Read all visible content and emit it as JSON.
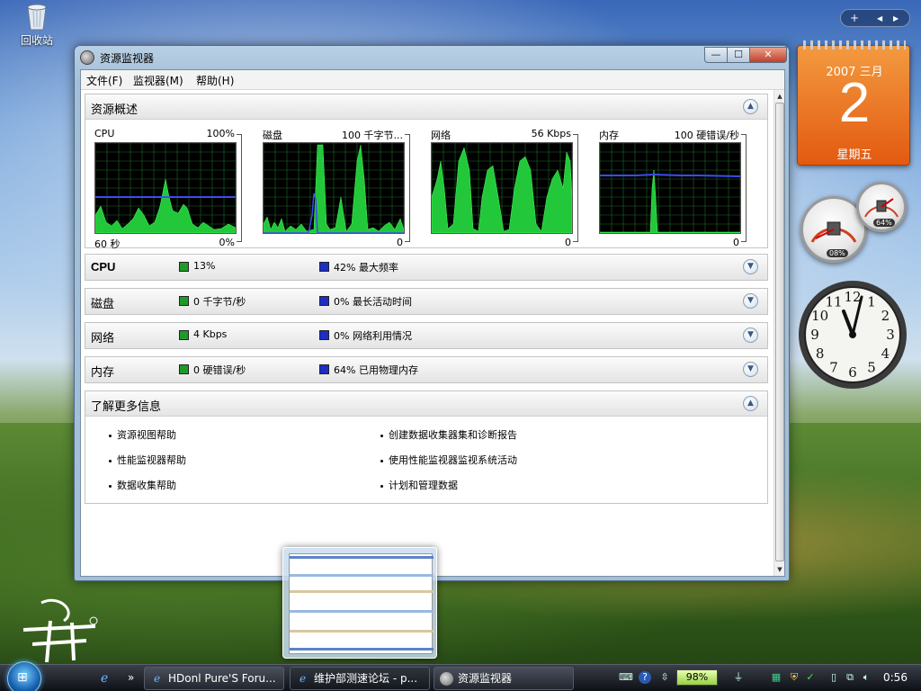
{
  "desktop": {
    "recycle_label": "回收站"
  },
  "window": {
    "title": "资源监视器",
    "controls": {
      "close_symbol": "✕",
      "min_symbol": "—",
      "max_symbol": "☐"
    },
    "menu": [
      {
        "label": "文件(F)"
      },
      {
        "label": "监视器(M)"
      },
      {
        "label": "帮助(H)"
      }
    ],
    "overview": {
      "title": "资源概述",
      "graphs": [
        {
          "label": "CPU",
          "scale": "100%",
          "foot_left": "60 秒",
          "foot_right": "0%"
        },
        {
          "label": "磁盘",
          "scale": "100 千字节...",
          "foot_left": "",
          "foot_right": "0"
        },
        {
          "label": "网络",
          "scale": "56 Kbps",
          "foot_left": "",
          "foot_right": "0"
        },
        {
          "label": "内存",
          "scale": "100 硬错误/秒",
          "foot_left": "",
          "foot_right": "0"
        }
      ]
    },
    "sections": [
      {
        "title": "CPU",
        "green_text": "13%",
        "blue_text": "42% 最大频率"
      },
      {
        "title": "磁盘",
        "green_text": "0 千字节/秒",
        "blue_text": "0% 最长活动时间"
      },
      {
        "title": "网络",
        "green_text": "4 Kbps",
        "blue_text": "0% 网络利用情况"
      },
      {
        "title": "内存",
        "green_text": "0 硬错误/秒",
        "blue_text": "64% 已用物理内存"
      }
    ],
    "learn_more": {
      "title": "了解更多信息",
      "links": [
        "资源视图帮助",
        "创建数据收集器集和诊断报告",
        "性能监视器帮助",
        "使用性能监视器监视系统活动",
        "数据收集帮助",
        "计划和管理数据"
      ]
    }
  },
  "gadgets": {
    "calendar": {
      "year_month": "2007 三月",
      "day": "2",
      "weekday": "星期五"
    },
    "meter_cpu": "08%",
    "meter_mem": "64%",
    "clock_numbers": [
      "12",
      "1",
      "2",
      "3",
      "4",
      "5",
      "6",
      "7",
      "8",
      "9",
      "10",
      "11"
    ],
    "strip": {
      "add": "+",
      "prev": "◀",
      "next": "▶"
    }
  },
  "taskbar": {
    "buttons": [
      {
        "label": "HDonl Pure'S Foru..."
      },
      {
        "label": "维护部测速论坛 - p..."
      },
      {
        "label": "资源监视器"
      }
    ],
    "battery": "98%",
    "time": "0:56",
    "quick_more": "»"
  },
  "colors": {
    "graph_green": "#22c83a",
    "graph_blue": "#3c4cf0",
    "graph_grid": "#1f6a28"
  },
  "icons": [
    "recycle-bin-icon",
    "resource-monitor-icon",
    "chevron-up-icon",
    "chevron-down-icon",
    "ie-icon",
    "windows-orb-icon"
  ]
}
